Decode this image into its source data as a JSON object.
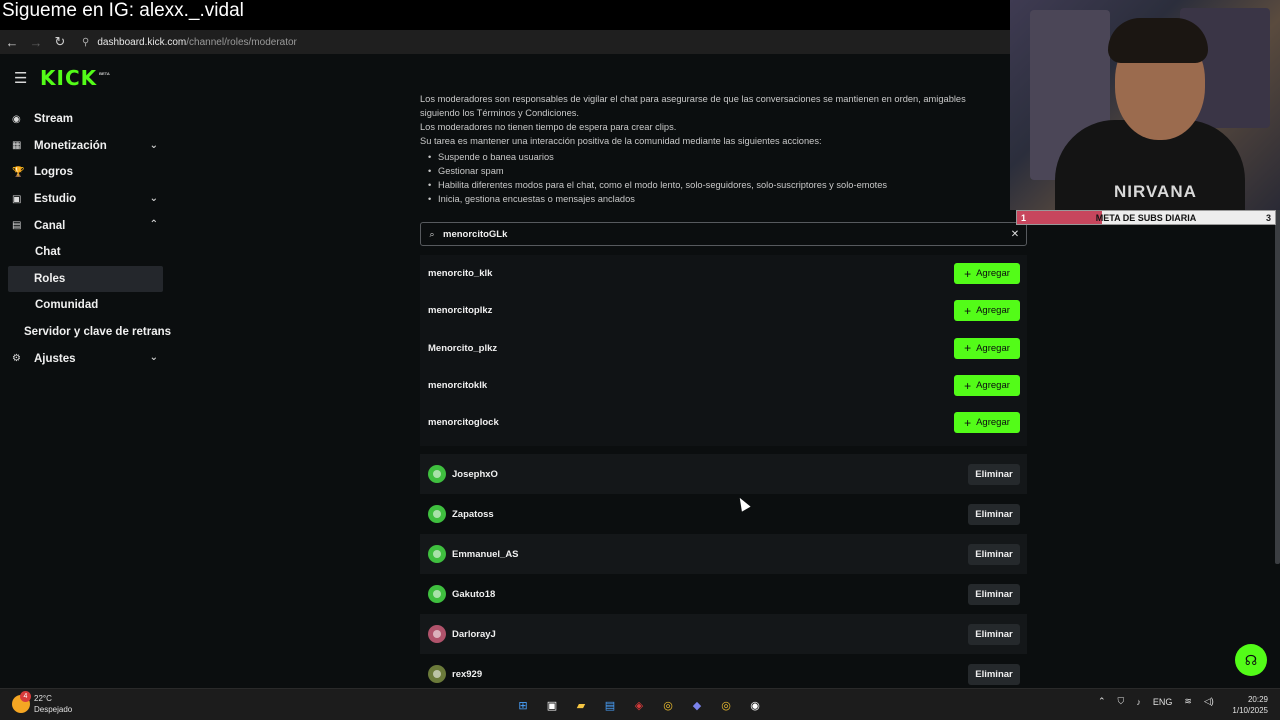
{
  "overlay": {
    "text": "Sigueme en IG: alexx._.vidal"
  },
  "browser": {
    "url_domain": "dashboard.kick.com",
    "url_path": "/channel/roles/moderator",
    "back_icon": "arrow-left-icon",
    "forward_icon": "arrow-right-icon",
    "reload_icon": "reload-icon"
  },
  "brand": {
    "logo": "KICK",
    "badge": "BETA"
  },
  "sidebar": {
    "items": [
      {
        "label": "Stream",
        "icon": "◉"
      },
      {
        "label": "Monetización",
        "icon": "▦",
        "chevron": "⌄"
      },
      {
        "label": "Logros",
        "icon": "🏆"
      },
      {
        "label": "Estudio",
        "icon": "▣",
        "chevron": "⌄"
      },
      {
        "label": "Canal",
        "icon": "▤",
        "chevron": "⌃"
      },
      {
        "label": "Chat"
      },
      {
        "label": "Roles"
      },
      {
        "label": "Comunidad"
      },
      {
        "label": "Servidor y clave de retrans"
      },
      {
        "label": "Ajustes",
        "icon": "⚙",
        "chevron": "⌄"
      }
    ]
  },
  "main": {
    "intro_line1": "Los moderadores son responsables de vigilar el chat para asegurarse de que las conversaciones se mantienen en orden, amigables",
    "intro_line2": "siguiendo los Términos y Condiciones.",
    "intro_line3": "Los moderadores no tienen tiempo de espera para crear clips.",
    "intro_line4": "Su tarea es mantener una interacción positiva de la comunidad mediante las siguientes acciones:",
    "bullets": [
      "Suspende o banea usuarios",
      "Gestionar spam",
      "Habilita diferentes modos para el chat, como el modo lento, solo-seguidores, solo-suscriptores y solo-emotes",
      "Inicia, gestiona encuestas o mensajes anclados"
    ]
  },
  "search": {
    "value": "menorcitoGLk"
  },
  "results": {
    "add_label": "Agregar",
    "items": [
      "menorcito_klk",
      "menorcitoplkz",
      "Menorcito_plkz",
      "menorcitoklk",
      "menorcitoglock"
    ]
  },
  "moderators": {
    "remove_label": "Eliminar",
    "items": [
      {
        "name": "JosephxO",
        "color": "#3fbf3f"
      },
      {
        "name": "Zapatoss",
        "color": "#3fbf3f"
      },
      {
        "name": "Emmanuel_AS",
        "color": "#3fbf3f"
      },
      {
        "name": "Gakuto18",
        "color": "#3fbf3f"
      },
      {
        "name": "DarlorayJ",
        "color": "#b0536b"
      },
      {
        "name": "rex929",
        "color": "#6b7a3a"
      }
    ]
  },
  "webcam": {
    "shirt_text": "NIRVANA"
  },
  "goal": {
    "left": "1",
    "label": "META DE SUBS DIARIA",
    "right": "3",
    "progress_percent": 33
  },
  "taskbar": {
    "weather_temp": "22°C",
    "weather_desc": "Despejado",
    "weather_badge": "4",
    "language": "ENG",
    "time": "20:29",
    "date": "1/10/2025"
  },
  "colors": {
    "accent": "#53fc18",
    "bg": "#0b0e0f"
  }
}
